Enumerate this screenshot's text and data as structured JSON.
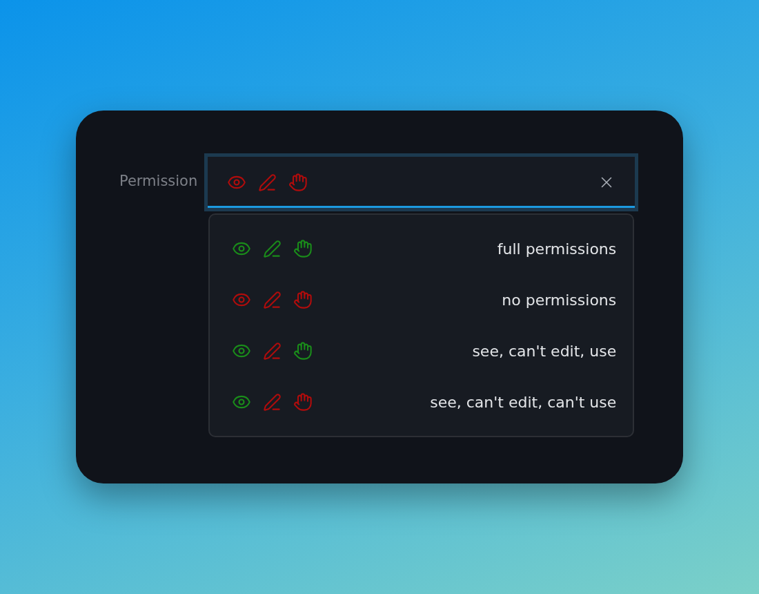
{
  "field": {
    "label": "Permission",
    "value": {
      "see": false,
      "edit": false,
      "use": false
    }
  },
  "options": [
    {
      "label": "full permissions",
      "see": true,
      "edit": true,
      "use": true
    },
    {
      "label": "no permissions",
      "see": false,
      "edit": false,
      "use": false
    },
    {
      "label": "see, can't edit, use",
      "see": true,
      "edit": false,
      "use": true
    },
    {
      "label": "see, can't edit, can't use",
      "see": true,
      "edit": false,
      "use": false
    }
  ]
}
